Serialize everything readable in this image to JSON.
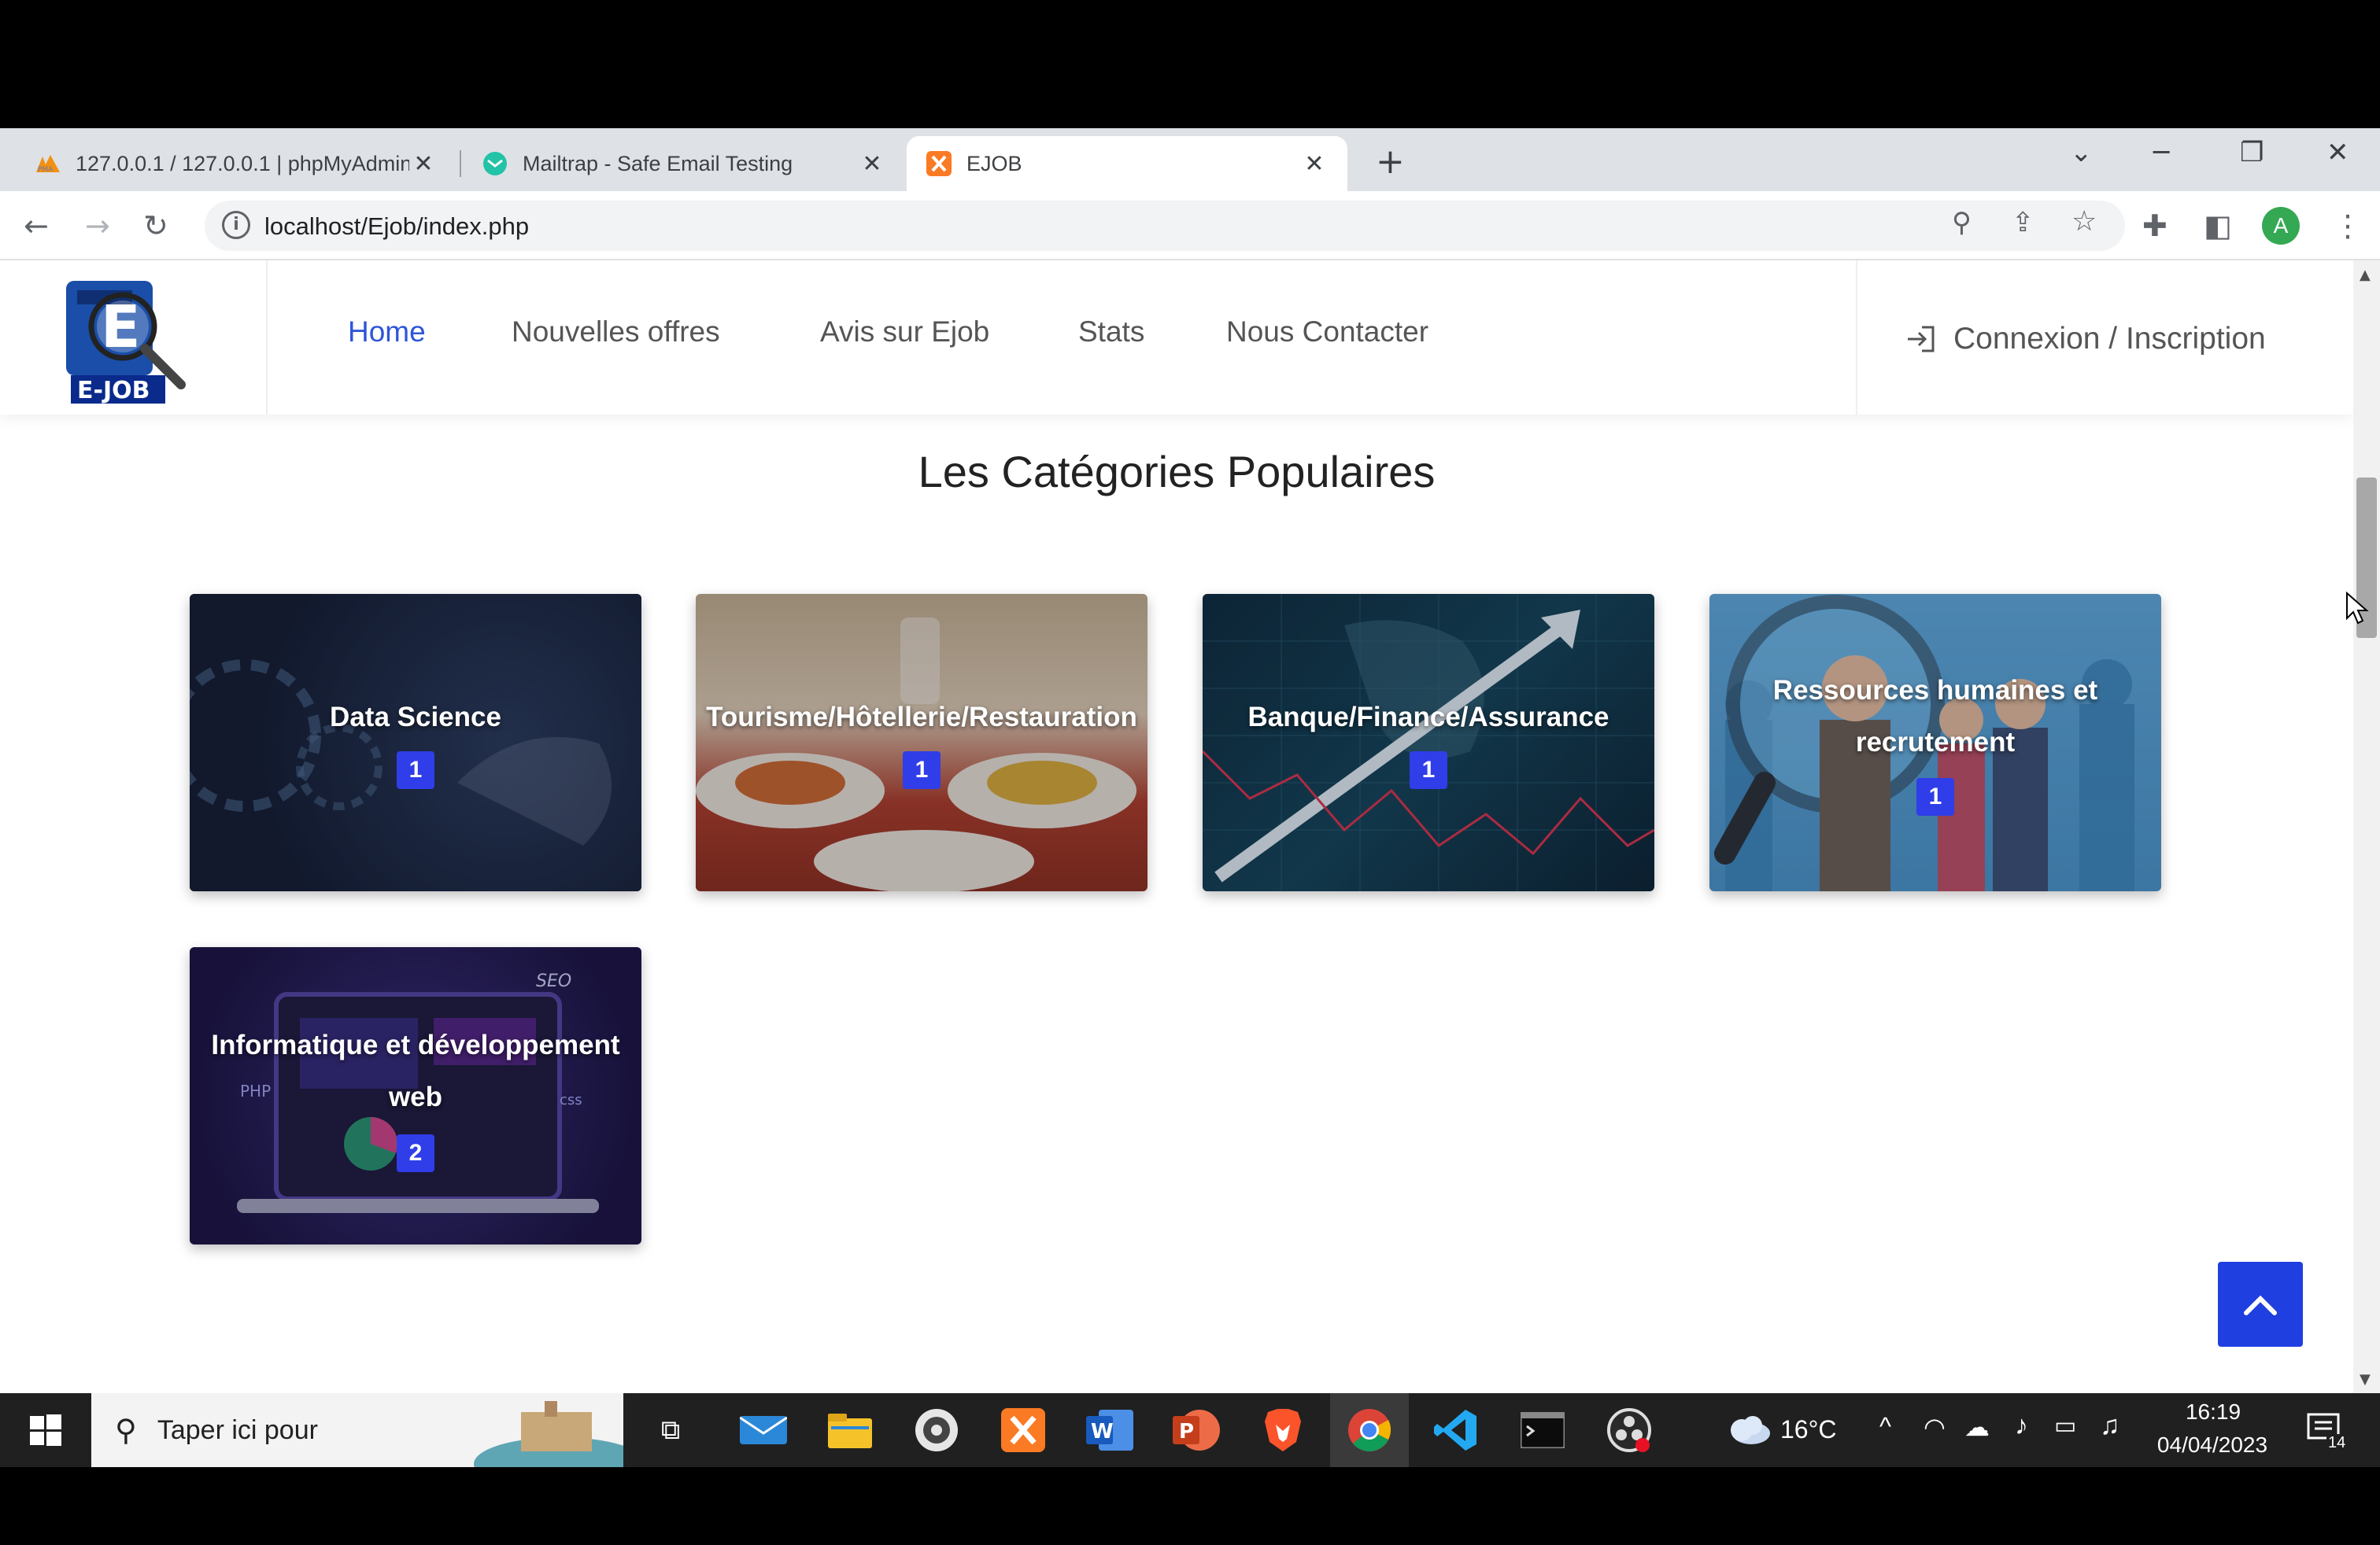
{
  "browser": {
    "tabs": [
      {
        "title": "127.0.0.1 / 127.0.0.1 | phpMyAdmin",
        "close": "✕"
      },
      {
        "title": "Mailtrap - Safe Email Testing",
        "close": "✕"
      },
      {
        "title": "EJOB",
        "close": "✕"
      }
    ],
    "new_tab": "+",
    "url": "localhost/Ejob/index.php",
    "profile_initial": "A"
  },
  "nav": {
    "logo_text": "E-JOB",
    "links": [
      "Home",
      "Nouvelles offres",
      "Avis sur Ejob",
      "Stats",
      "Nous Contacter"
    ],
    "login": "Connexion / Inscription"
  },
  "section": {
    "title": "Les Catégories Populaires"
  },
  "categories": [
    {
      "name": "Data Science",
      "count": "1"
    },
    {
      "name": "Tourisme/Hôtellerie/Restauration",
      "count": "1"
    },
    {
      "name": "Banque/Finance/Assurance",
      "count": "1"
    },
    {
      "name": "Ressources humaines et recrutement",
      "count": "1"
    },
    {
      "name": "Informatique et développement web",
      "count": "2"
    }
  ],
  "taskbar": {
    "search_placeholder": "Taper ici pour",
    "weather": "16°C",
    "time": "16:19",
    "date": "04/04/2023",
    "notifications": "14"
  }
}
